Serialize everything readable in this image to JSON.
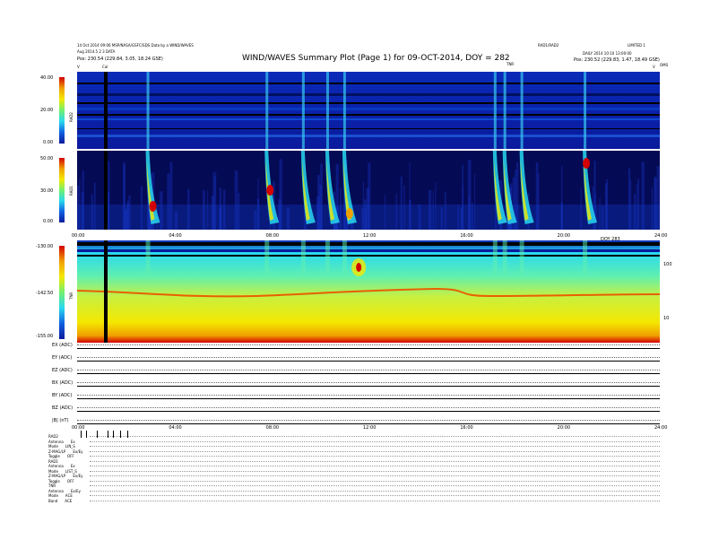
{
  "header": {
    "title": "WIND/WAVES Summary Plot (Page 1) for 09-OCT-2014, DOY = 282",
    "left_line1": "14 Oct 2014 09:06 MSP/NASA/GSFC/SDS Data by a WIND/WAVES",
    "left_line2": "Aug 2014.5 2 3 DATA",
    "left_line3": "Pos: 230.54 (229.84, 3.05, 18.24 GSE)",
    "right_line1": "RAD1/RAD2",
    "right_line2": "LIMITED 1",
    "right_line3": "DAILY 2014 10:10 13:00:00",
    "right_line4": "Pos: 230.52 (229.83, 1.47, 18.49 GSE)",
    "tnr_label": "TNR",
    "cal_label": "Cal",
    "v_left": "V",
    "v_right": "V",
    "end_label": "OMS"
  },
  "panels": [
    {
      "name": "RAD2",
      "ticks": [
        "40.00",
        "20.00",
        "0.00"
      ],
      "ylabel": "RAD2"
    },
    {
      "name": "RAD1",
      "ticks": [
        "50.00",
        "30.00",
        "0.00"
      ],
      "ylabel": "RAD1"
    },
    {
      "name": "TNR",
      "ticks": [
        "-130.00",
        "-142.50",
        "-155.00"
      ],
      "ylabel": "TNR",
      "right_ticks": [
        "100",
        "10"
      ]
    }
  ],
  "time_axis_1": [
    "00:00",
    "04:00",
    "08:00",
    "12:00",
    "16:00",
    "20:00",
    "24:00"
  ],
  "time_axis_2": [
    "00:00",
    "04:00",
    "08:00",
    "12:00",
    "16:00",
    "20:00",
    "24:00"
  ],
  "doy_label": "DOY 283",
  "channels": [
    {
      "label": "EX (ADC)"
    },
    {
      "label": "EY (ADC)"
    },
    {
      "label": "EZ (ADC)"
    },
    {
      "label": "BX (ADC)"
    },
    {
      "label": "BY (ADC)"
    },
    {
      "label": "BZ (ADC)"
    },
    {
      "label": "|B| (nT)"
    }
  ],
  "legend": [
    {
      "k": "RAD2",
      "v": ""
    },
    {
      "k": "Antenna",
      "v": "Ex"
    },
    {
      "k": "Mode",
      "v": "LIN_S"
    },
    {
      "k": "Z-MAG/LP",
      "v": "Ex/Ey"
    },
    {
      "k": "Toggle",
      "v": "OFF"
    },
    {
      "k": "RAD1",
      "v": ""
    },
    {
      "k": "Antenna",
      "v": "Ex"
    },
    {
      "k": "Mode",
      "v": "LIST_S"
    },
    {
      "k": "Z-MAG/LP",
      "v": "Ex/Ey"
    },
    {
      "k": "Toggle",
      "v": "OFF"
    },
    {
      "k": "TNR",
      "v": ""
    },
    {
      "k": "Antenna",
      "v": "Ex/Ey"
    },
    {
      "k": "Mode",
      "v": "ACE"
    },
    {
      "k": "Band",
      "v": "ACE"
    }
  ],
  "colors": {
    "background": "#0a1a9c",
    "accent_red": "#d40000",
    "accent_yellow": "#f4e800",
    "accent_cyan": "#28d8f0"
  },
  "chart_data": {
    "type": "heatmap",
    "title": "WIND/WAVES Summary Plot (Page 1) for 09-OCT-2014, DOY = 282",
    "xlabel": "",
    "xlim": [
      0,
      24
    ],
    "x_ticks": [
      0,
      4,
      8,
      12,
      16,
      20,
      24
    ],
    "radio_bursts_hours": [
      2.9,
      7.8,
      9.3,
      10.3,
      11.0,
      17.2,
      17.6,
      18.3,
      20.9
    ],
    "rad2_ylim": [
      0,
      40
    ],
    "rad1_ylim": [
      0,
      50
    ],
    "tnr_ylim": [
      -155,
      -130
    ]
  }
}
